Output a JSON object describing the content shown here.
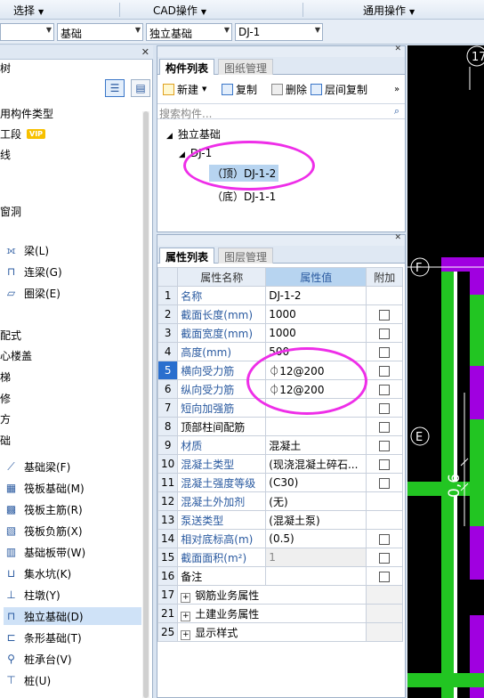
{
  "menu": {
    "select": "选择",
    "cad": "CAD操作",
    "common": "通用操作"
  },
  "selectors": {
    "floor": "",
    "category": "基础",
    "type": "独立基础",
    "component": "DJ-1"
  },
  "left_panel": {
    "title": "树",
    "items": [
      {
        "label": "用构件类型",
        "icon": ""
      },
      {
        "label": "工段",
        "icon": "",
        "badge": "VIP"
      },
      {
        "label": "线",
        "icon": ""
      },
      {
        "label": "窗洞",
        "icon": ""
      },
      {
        "label": "梁(L)",
        "icon": "beam-icon"
      },
      {
        "label": "连梁(G)",
        "icon": "link-beam-icon"
      },
      {
        "label": "圈梁(E)",
        "icon": "ring-beam-icon"
      },
      {
        "label": "配式",
        "icon": ""
      },
      {
        "label": "心楼盖",
        "icon": ""
      },
      {
        "label": "梯",
        "icon": ""
      },
      {
        "label": "修",
        "icon": ""
      },
      {
        "label": "方",
        "icon": ""
      },
      {
        "label": "础",
        "icon": ""
      },
      {
        "label": "基础梁(F)",
        "icon": "foundation-beam-icon"
      },
      {
        "label": "筏板基础(M)",
        "icon": "raft-icon"
      },
      {
        "label": "筏板主筋(R)",
        "icon": "raft-main-rebar-icon"
      },
      {
        "label": "筏板负筋(X)",
        "icon": "raft-neg-rebar-icon"
      },
      {
        "label": "基础板带(W)",
        "icon": "slab-strip-icon"
      },
      {
        "label": "集水坑(K)",
        "icon": "sump-icon"
      },
      {
        "label": "柱墩(Y)",
        "icon": "column-pier-icon"
      },
      {
        "label": "独立基础(D)",
        "icon": "isolated-footing-icon"
      },
      {
        "label": "条形基础(T)",
        "icon": "strip-footing-icon"
      },
      {
        "label": "桩承台(V)",
        "icon": "pile-cap-icon"
      },
      {
        "label": "桩(U)",
        "icon": "pile-icon"
      }
    ]
  },
  "comp_panel": {
    "tabs": [
      "构件列表",
      "图纸管理"
    ],
    "toolbar": {
      "new": "新建",
      "copy": "复制",
      "delete": "删除",
      "floor_copy": "层间复制"
    },
    "search_placeholder": "搜索构件...",
    "tree": {
      "root": "独立基础",
      "child": "DJ-1",
      "leaf1": "（顶）DJ-1-2",
      "leaf2": "（底）DJ-1-1"
    }
  },
  "prop_panel": {
    "tabs": [
      "属性列表",
      "图层管理"
    ],
    "headers": {
      "name": "属性名称",
      "value": "属性值",
      "extra": "附加"
    },
    "rows": [
      {
        "n": "1",
        "name": "名称",
        "value": "DJ-1-2",
        "blue": true,
        "cb": false
      },
      {
        "n": "2",
        "name": "截面长度(mm)",
        "value": "1000",
        "blue": true,
        "cb": true
      },
      {
        "n": "3",
        "name": "截面宽度(mm)",
        "value": "1000",
        "blue": true,
        "cb": true
      },
      {
        "n": "4",
        "name": "高度(mm)",
        "value": "500",
        "blue": true,
        "cb": true
      },
      {
        "n": "5",
        "name": "横向受力筋",
        "value": "⏀12@200",
        "blue": true,
        "cb": true
      },
      {
        "n": "6",
        "name": "纵向受力筋",
        "value": "⏀12@200",
        "blue": true,
        "cb": true
      },
      {
        "n": "7",
        "name": "短向加强筋",
        "value": "",
        "blue": true,
        "cb": true
      },
      {
        "n": "8",
        "name": "顶部柱间配筋",
        "value": "",
        "blue": false,
        "cb": true
      },
      {
        "n": "9",
        "name": "材质",
        "value": "混凝土",
        "blue": true,
        "cb": true
      },
      {
        "n": "10",
        "name": "混凝土类型",
        "value": "(现浇混凝土碎石...",
        "blue": true,
        "cb": true
      },
      {
        "n": "11",
        "name": "混凝土强度等级",
        "value": "(C30)",
        "blue": true,
        "cb": true
      },
      {
        "n": "12",
        "name": "混凝土外加剂",
        "value": "(无)",
        "blue": true,
        "cb": false
      },
      {
        "n": "13",
        "name": "泵送类型",
        "value": "(混凝土泵)",
        "blue": true,
        "cb": false
      },
      {
        "n": "14",
        "name": "相对底标高(m)",
        "value": "(0.5)",
        "blue": true,
        "cb": true
      },
      {
        "n": "15",
        "name": "截面面积(m²)",
        "value": "1",
        "blue": true,
        "cb": true
      },
      {
        "n": "16",
        "name": "备注",
        "value": "",
        "blue": false,
        "cb": true
      }
    ],
    "groups": [
      {
        "n": "17",
        "label": "钢筋业务属性"
      },
      {
        "n": "21",
        "label": "土建业务属性"
      },
      {
        "n": "25",
        "label": "显示样式"
      }
    ]
  },
  "canvas": {
    "label_top": "17",
    "axis_f": "F",
    "axis_e": "E",
    "dim_text": "0,6"
  },
  "colors": {
    "accent": "#2a6fce",
    "highlight": "#ee2ee8",
    "green": "#22c522",
    "purple": "#a000e0"
  }
}
